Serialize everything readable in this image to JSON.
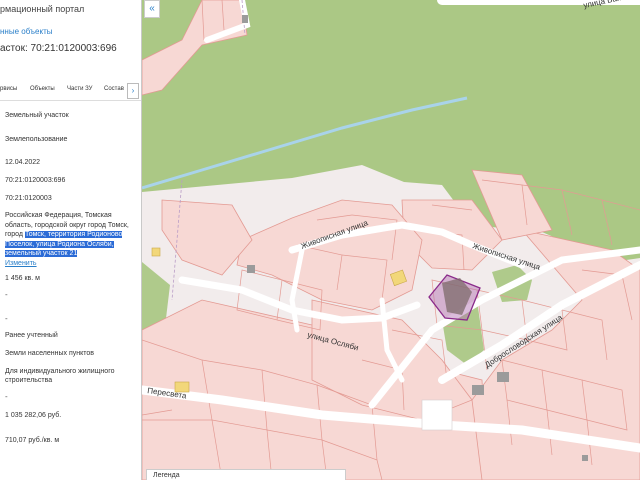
{
  "panel": {
    "portal_title": "рмационный портал",
    "link_text": "нные объекты",
    "parcel_label": "асток: 70:21:0120003:696",
    "tabs": [
      "рвисы",
      "Объекты",
      "Части ЗУ",
      "Состав"
    ],
    "tab_more": "›",
    "fields": {
      "type": "Земельный участок",
      "category_group": "Землепользование",
      "date": "12.04.2022",
      "cad_number": "70:21:0120003:696",
      "quarter": "70:21:0120003",
      "address_plain": "Российская Федерация, Томская область, городской округ город Томск, город ",
      "address_highlight": "Томск, территория Родионово Поселок, улица Родиона Осляби, земельный участок 21",
      "edit_link": "Изменить",
      "area": "1 456 кв. м",
      "dash1": "-",
      "dash2": "-",
      "status": "Ранее учтенный",
      "land_category": "Земли населенных пунктов",
      "permitted_use": "Для индивидуального жилищного строительства",
      "dash3": "-",
      "cadastral_value": "1 035 282,06 руб.",
      "unit_value": "710,07 руб./кв. м"
    }
  },
  "map": {
    "collapse_icon": "«",
    "bottom_bar_label": "Легенда",
    "streets": [
      "улица Байк",
      "Живописная улица",
      "Живописная улица",
      "улица Осляби",
      "Добрословодская улица",
      "Пересвета"
    ],
    "colors": {
      "background": "#f2ecec",
      "parcel_fill": "#f7d8d4",
      "parcel_stroke": "#e39a93",
      "forest": "#a3c47a",
      "road": "#ffffff",
      "river": "#a9d3ea",
      "selected": "#b06ab0"
    }
  }
}
